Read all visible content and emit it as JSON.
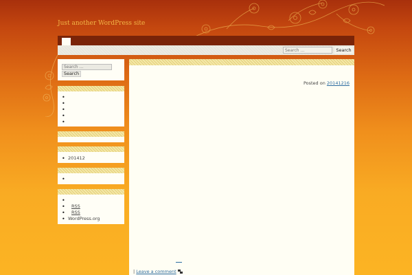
{
  "site": {
    "tagline": "Just another WordPress site"
  },
  "top_search": {
    "placeholder": "Search ...",
    "button": "Search"
  },
  "sidebar": {
    "search": {
      "placeholder": "Search ...",
      "button": "Search"
    },
    "archives": [
      "201412"
    ],
    "meta": {
      "items": [
        "RSS",
        "RSS",
        "WordPress.org"
      ]
    }
  },
  "post": {
    "posted_on_label": "Posted on",
    "date": "20141216",
    "footer_separator": "|",
    "leave_comment": "Leave a comment"
  },
  "colors": {
    "background_top": "#a8300c",
    "background_bottom": "#fcb423",
    "nav_bar": "#7a2408",
    "content_bg": "#fffef4",
    "link": "#2a6aa0",
    "tagline": "#f2b646"
  }
}
